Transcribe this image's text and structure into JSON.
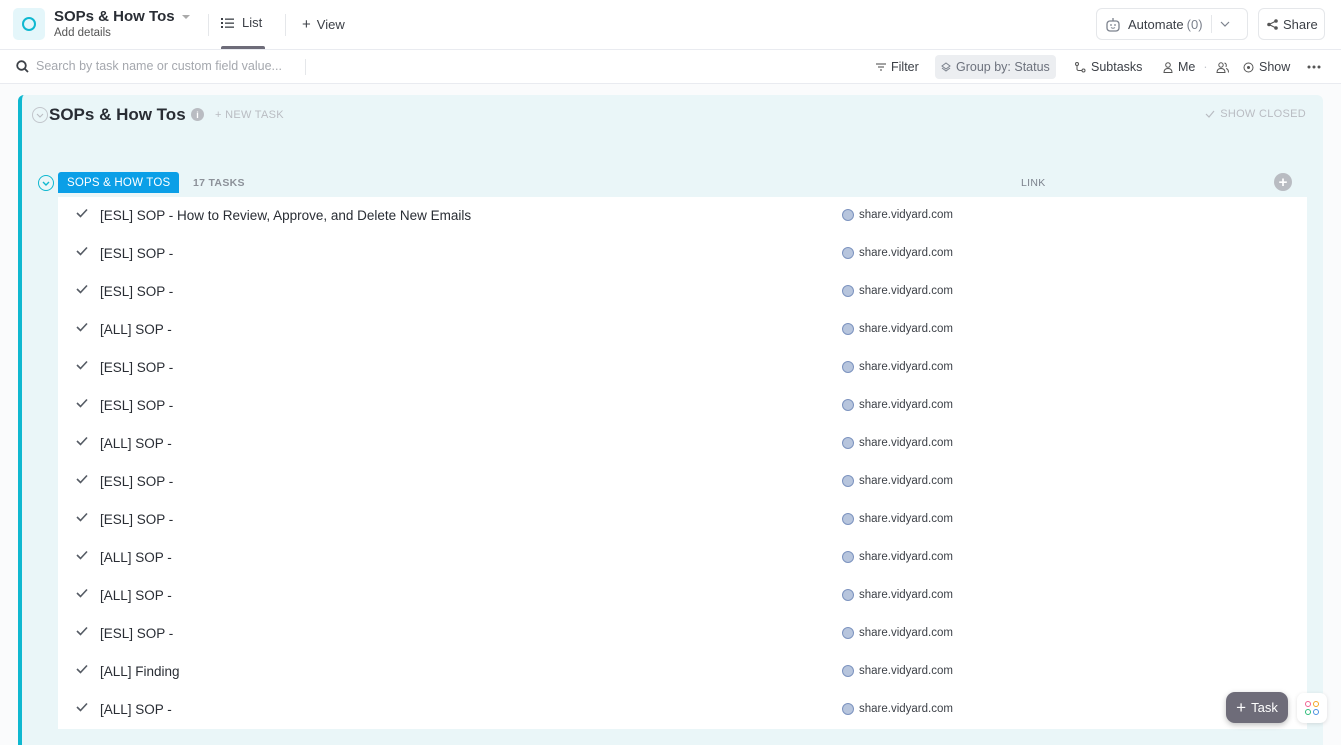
{
  "header": {
    "space_title": "SOPs & How Tos",
    "subtitle": "Add details",
    "tabs": [
      {
        "label": "List",
        "active": true
      },
      {
        "label": "View",
        "prefix": "+"
      }
    ],
    "automate_label": "Automate",
    "automate_count": "(0)",
    "share_label": "Share"
  },
  "toolbar": {
    "search_placeholder": "Search by task name or custom field value...",
    "filter_label": "Filter",
    "group_by_label": "Group by: Status",
    "subtasks_label": "Subtasks",
    "me_label": "Me",
    "show_label": "Show"
  },
  "list": {
    "title": "SOPs & How Tos",
    "new_task_label": "+ NEW TASK",
    "show_closed_label": "SHOW CLOSED",
    "group": {
      "status": "SOPS & HOW TOS",
      "status_color": "#0b9fe7",
      "task_count": "17 TASKS",
      "column_link": "LINK"
    },
    "tasks": [
      {
        "name": "[ESL] SOP - How to Review, Approve, and Delete New Emails",
        "link": "share.vidyard.com"
      },
      {
        "name": "[ESL] SOP -",
        "link": "share.vidyard.com"
      },
      {
        "name": "[ESL] SOP -",
        "link": "share.vidyard.com"
      },
      {
        "name": "[ALL] SOP -",
        "link": "share.vidyard.com"
      },
      {
        "name": "[ESL] SOP -",
        "link": "share.vidyard.com"
      },
      {
        "name": "[ESL] SOP -",
        "link": "share.vidyard.com"
      },
      {
        "name": "[ALL] SOP -",
        "link": "share.vidyard.com"
      },
      {
        "name": "[ESL] SOP -",
        "link": "share.vidyard.com"
      },
      {
        "name": "[ESL] SOP -",
        "link": "share.vidyard.com"
      },
      {
        "name": "[ALL] SOP -",
        "link": "share.vidyard.com"
      },
      {
        "name": "[ALL] SOP -",
        "link": "share.vidyard.com"
      },
      {
        "name": "[ESL] SOP -",
        "link": "share.vidyard.com"
      },
      {
        "name": "[ALL] Finding",
        "link": "share.vidyard.com"
      },
      {
        "name": "[ALL] SOP -",
        "link": "share.vidyard.com"
      }
    ]
  },
  "floating": {
    "task_button_label": "Task"
  },
  "colors": {
    "accent": "#0fb8d0",
    "status": "#0b9fe7"
  }
}
